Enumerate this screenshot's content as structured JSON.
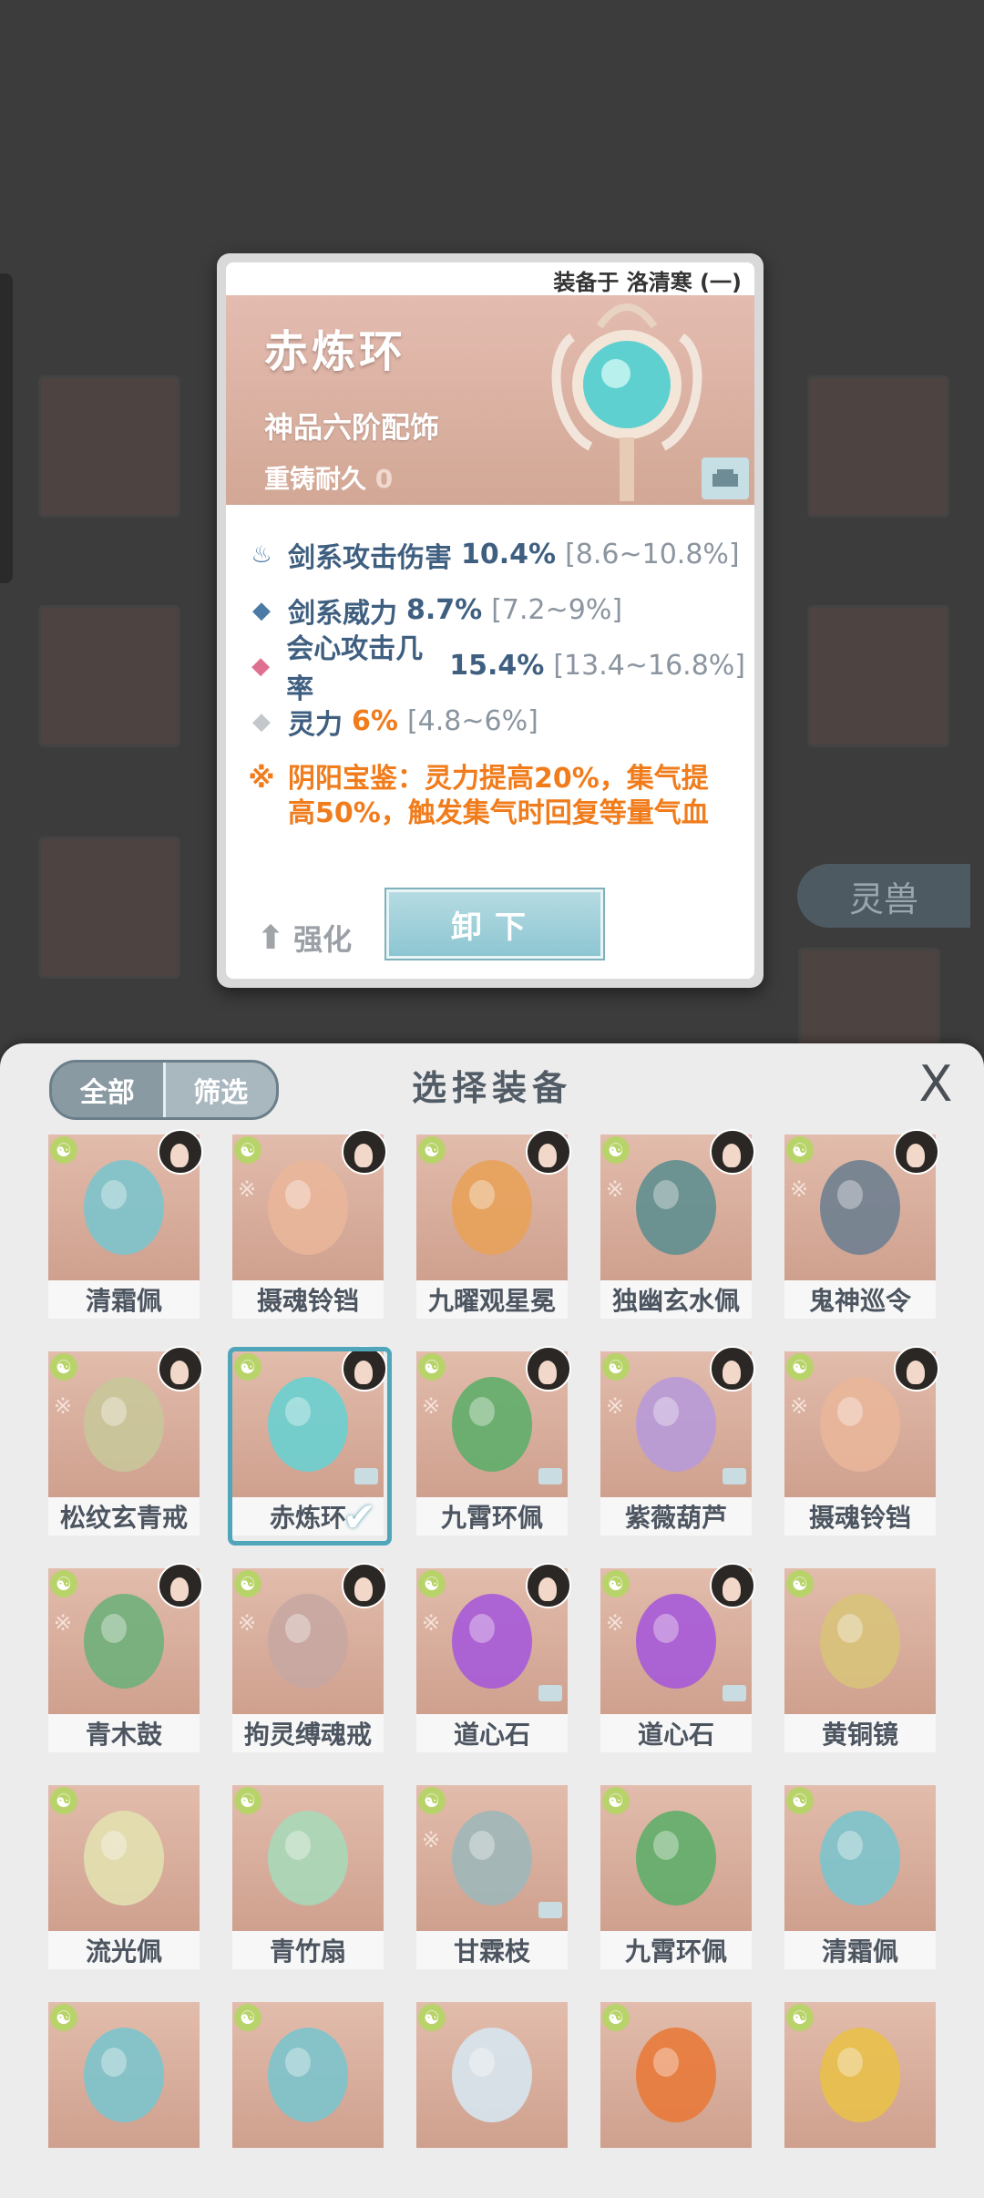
{
  "detail": {
    "equipped_on": "装备于 洛清寒 (一)",
    "name": "赤炼环",
    "grade": "神品六阶配饰",
    "durability_label": "重铸耐久",
    "durability_value": "0",
    "stats": [
      {
        "icon": "flame-icon",
        "name": "剑系攻击伤害",
        "value": "10.4%",
        "range": "[8.6~10.8%]",
        "color": "#3f5f80"
      },
      {
        "icon": "diamond-blue-icon",
        "name": "剑系威力",
        "value": "8.7%",
        "range": "[7.2~9%]",
        "color": "#3f5f80"
      },
      {
        "icon": "diamond-pink-icon",
        "name": "会心攻击几率",
        "value": "15.4%",
        "range": "[13.4~16.8%]",
        "color": "#3f5f80"
      },
      {
        "icon": "diamond-gray-icon",
        "name": "灵力",
        "value": "6%",
        "range": "[4.8~6%]",
        "color": "#f07c1c"
      }
    ],
    "set_bonus": "阴阳宝鉴：灵力提高20%，集气提高50%，触发集气时回复等量气血",
    "upgrade_label": "强化",
    "unequip_label": "卸下"
  },
  "background": {
    "spirit_beast_tab": "灵兽"
  },
  "panel": {
    "tab_all": "全部",
    "tab_filter": "筛选",
    "title": "选择装备",
    "close": "X",
    "items": [
      {
        "name": "清霜佩",
        "avatar": true,
        "set": false,
        "locked": false
      },
      {
        "name": "摄魂铃铛",
        "avatar": true,
        "set": true,
        "locked": false
      },
      {
        "name": "九曜观星冕",
        "avatar": true,
        "set": false,
        "locked": false
      },
      {
        "name": "独幽玄水佩",
        "avatar": true,
        "set": true,
        "locked": false
      },
      {
        "name": "鬼神巡令",
        "avatar": true,
        "set": true,
        "locked": false
      },
      {
        "name": "松纹玄青戒",
        "avatar": true,
        "set": true,
        "locked": false
      },
      {
        "name": "赤炼环",
        "avatar": true,
        "set": false,
        "locked": true,
        "selected": true
      },
      {
        "name": "九霄环佩",
        "avatar": true,
        "set": true,
        "locked": true
      },
      {
        "name": "紫薇葫芦",
        "avatar": true,
        "set": true,
        "locked": true
      },
      {
        "name": "摄魂铃铛",
        "avatar": true,
        "set": true,
        "locked": false
      },
      {
        "name": "青木鼓",
        "avatar": true,
        "set": true,
        "locked": false
      },
      {
        "name": "拘灵缚魂戒",
        "avatar": true,
        "set": true,
        "locked": false
      },
      {
        "name": "道心石",
        "avatar": true,
        "set": true,
        "locked": true
      },
      {
        "name": "道心石",
        "avatar": true,
        "set": true,
        "locked": true
      },
      {
        "name": "黄铜镜",
        "avatar": false,
        "set": false,
        "locked": false
      },
      {
        "name": "流光佩",
        "avatar": false,
        "set": false,
        "locked": false
      },
      {
        "name": "青竹扇",
        "avatar": false,
        "set": false,
        "locked": false
      },
      {
        "name": "甘霖枝",
        "avatar": false,
        "set": true,
        "locked": true
      },
      {
        "name": "九霄环佩",
        "avatar": false,
        "set": false,
        "locked": false
      },
      {
        "name": "清霜佩",
        "avatar": false,
        "set": false,
        "locked": false
      },
      {
        "name": "",
        "avatar": false,
        "set": false,
        "locked": false
      },
      {
        "name": "",
        "avatar": false,
        "set": false,
        "locked": false
      },
      {
        "name": "",
        "avatar": false,
        "set": false,
        "locked": false
      },
      {
        "name": "",
        "avatar": false,
        "set": false,
        "locked": false
      },
      {
        "name": "",
        "avatar": false,
        "set": false,
        "locked": false
      }
    ]
  }
}
